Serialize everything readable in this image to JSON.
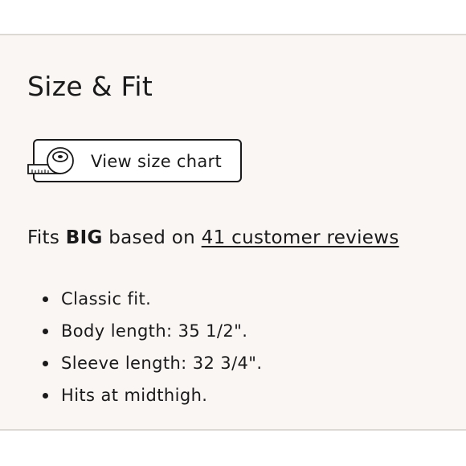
{
  "section": {
    "title": "Size & Fit"
  },
  "size_chart_button": {
    "label": "View size chart",
    "icon": "measuring-tape-icon"
  },
  "fit_summary": {
    "prefix": "Fits ",
    "fit": "BIG",
    "middle": " based on ",
    "reviews_link": "41 customer reviews"
  },
  "details": [
    "Classic fit.",
    "Body length: 35 1/2\".",
    "Sleeve length: 32 3/4\".",
    "Hits at midthigh."
  ]
}
